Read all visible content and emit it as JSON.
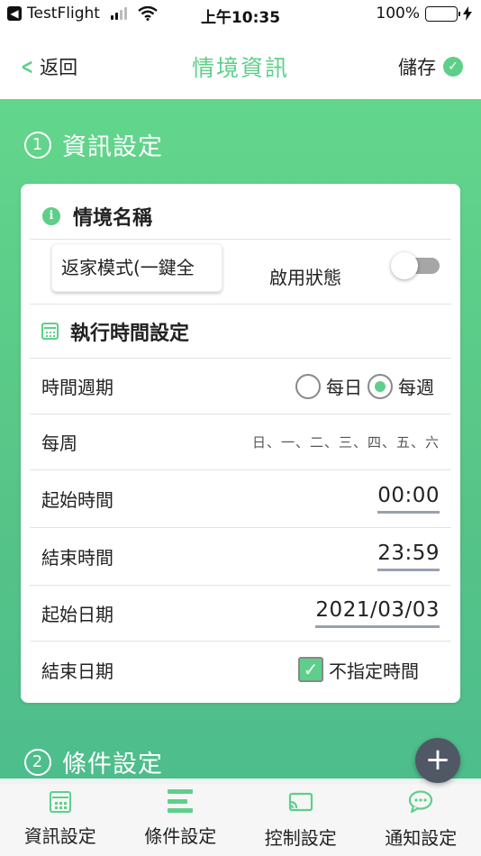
{
  "status_bar": {
    "back_app_label": "TestFlight",
    "time": "上午10:35",
    "battery_percent": "100%",
    "battery_level": 1.0
  },
  "nav": {
    "back_label": "返回",
    "title": "情境資訊",
    "save_label": "儲存"
  },
  "sections": {
    "info_number": "①",
    "info_title": "資訊設定",
    "condition_number": "②",
    "condition_title": "條件設定"
  },
  "card": {
    "scene_name_header": "情境名稱",
    "scene_name_value": "返家模式(一鍵全",
    "enable_label": "啟用狀態",
    "enable_on": false,
    "schedule_header": "執行時間設定",
    "period_label": "時間週期",
    "period_options": [
      "每日",
      "每週"
    ],
    "period_selected": "每週",
    "weekly_label": "每周",
    "weekdays": "日、一、二、三、四、五、六",
    "start_time_label": "起始時間",
    "start_time": "00:00",
    "end_time_label": "結束時間",
    "end_time": "23:59",
    "start_date_label": "起始日期",
    "start_date": "2021/03/03",
    "end_date_label": "結束日期",
    "end_date_checkbox_label": "不指定時間",
    "end_date_unspecified": true
  },
  "tabs": [
    {
      "label": "資訊設定",
      "icon": "calendar-icon"
    },
    {
      "label": "條件設定",
      "icon": "list-icon"
    },
    {
      "label": "控制設定",
      "icon": "cast-icon"
    },
    {
      "label": "通知設定",
      "icon": "chat-icon"
    }
  ],
  "colors": {
    "accent": "#5ecf8a",
    "fab": "#505866"
  }
}
